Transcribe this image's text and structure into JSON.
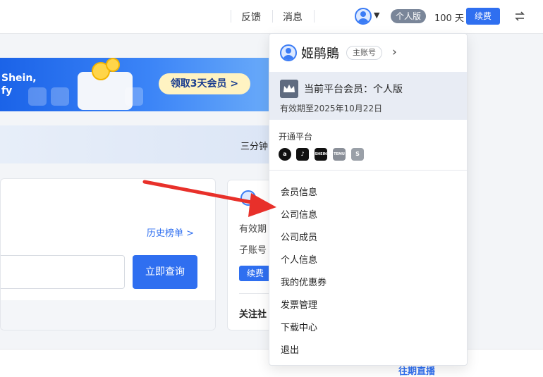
{
  "topbar": {
    "feedback": "反馈",
    "messages": "消息",
    "edition": "个人版",
    "days_left": "100 天",
    "renew": "续费"
  },
  "banner": {
    "brand": "Shein,\nfy",
    "cta": "领取3天会员 >"
  },
  "strip": {
    "text": "三分钟"
  },
  "search_card": {
    "history": "历史榜单 >",
    "query_button": "立即查询"
  },
  "member_card": {
    "line1": "有效期",
    "line2": "子账号",
    "renew": "续费",
    "follow": "关注社"
  },
  "lower": {
    "live": "往期直播"
  },
  "dropdown": {
    "user_name": "姬鹃鵙",
    "role": "主账号",
    "current_plan": "当前平台会员：个人版",
    "valid_until": "有效期至2025年10月22日",
    "platforms_label": "开通平台",
    "platforms": [
      {
        "name": "amazon-icon",
        "label": "a",
        "color": "#111111"
      },
      {
        "name": "tiktok-icon",
        "label": "♪",
        "color": "#111111"
      },
      {
        "name": "shein-icon",
        "label": "SHEIN",
        "color": "#111111"
      },
      {
        "name": "temu-icon",
        "label": "TEMU",
        "color": "#8a8f98"
      },
      {
        "name": "shopify-icon",
        "label": "S",
        "color": "#9aa0a8"
      }
    ],
    "menu": [
      "会员信息",
      "公司信息",
      "公司成员",
      "个人信息",
      "我的优惠券",
      "发票管理",
      "下载中心",
      "退出"
    ]
  },
  "colors": {
    "accent": "#2f6ff0",
    "annotation_arrow": "#e8302a"
  }
}
